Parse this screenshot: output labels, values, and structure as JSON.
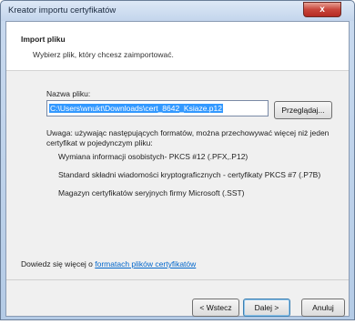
{
  "window": {
    "title": "Kreator importu certyfikatów",
    "close_glyph": "x"
  },
  "header": {
    "title": "Import pliku",
    "subtitle": "Wybierz plik, który chcesz zaimportować."
  },
  "file": {
    "label": "Nazwa pliku:",
    "value": "C:\\Users\\wnukt\\Downloads\\cert_8642_Ksiaze.p12",
    "browse_label": "Przeglądaj..."
  },
  "note": "Uwaga: używając następujących formatów, można przechowywać więcej niż jeden certyfikat w pojedynczym pliku:",
  "formats": [
    "Wymiana informacji osobistych- PKCS #12 (.PFX,.P12)",
    "Standard składni wiadomości kryptograficznych - certyfikaty PKCS #7 (.P7B)",
    "Magazyn certyfikatów seryjnych firmy Microsoft (.SST)"
  ],
  "more_info": {
    "prefix": "Dowiedz się więcej o ",
    "link": "formatach plików certyfikatów"
  },
  "buttons": {
    "back": "< Wstecz",
    "next": "Dalej >",
    "cancel": "Anuluj"
  }
}
